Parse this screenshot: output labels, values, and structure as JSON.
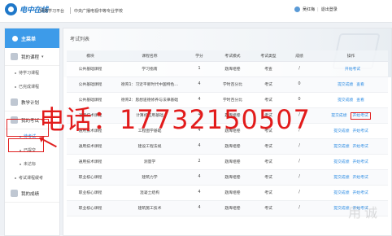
{
  "header": {
    "logo_text": "电中在线",
    "platform": "网络学习平台",
    "school": "中央广播电视中等专业学校",
    "user_name": "吴红梅",
    "logout": "退出登录"
  },
  "sidebar": {
    "title": "主菜单",
    "groups": [
      {
        "label": "我的课程"
      },
      {
        "label": "教学计划"
      },
      {
        "label": "我的考试"
      },
      {
        "label": "我的成绩"
      }
    ],
    "subs": [
      {
        "label": "待学习课程"
      },
      {
        "label": "已完成课程"
      },
      {
        "label": "待考试"
      },
      {
        "label": "已提交"
      },
      {
        "label": "未达标"
      },
      {
        "label": "考试课程缓考"
      }
    ]
  },
  "main": {
    "title": "考试列表",
    "columns": [
      "模块",
      "课程名称",
      "学分",
      "考试模式",
      "考试类型",
      "成绩",
      "操作"
    ],
    "rows": [
      {
        "module": "公共基础课程",
        "course": "学习指南",
        "credit": "1",
        "mode": "题库组卷",
        "type": "考查",
        "score": "/",
        "a1": "",
        "a2": "开始考试"
      },
      {
        "module": "公共基础课程",
        "course": "德育1：习近平新时代中国特色…",
        "credit": "4",
        "mode": "学时百分比",
        "type": "考试",
        "score": "0",
        "a1": "提交成绩",
        "a2": "查看"
      },
      {
        "module": "公共基础课程",
        "course": "德育2：思想道德修养与法律基础",
        "credit": "4",
        "mode": "学时百分比",
        "type": "考试",
        "score": "0",
        "a1": "提交成绩",
        "a2": "查看"
      },
      {
        "module": "通用技术课程",
        "course": "计算机应用基础",
        "credit": "4",
        "mode": "题库组卷",
        "type": "考试",
        "score": "/",
        "a1": "提交成绩",
        "a2": "开始考试"
      },
      {
        "module": "通用技术课程",
        "course": "工程图学基础",
        "credit": "4",
        "mode": "题库组卷",
        "type": "考试",
        "score": "/",
        "a1": "提交成绩",
        "a2": "开始考试"
      },
      {
        "module": "通用技术课程",
        "course": "建设工程法规",
        "credit": "4",
        "mode": "题库组卷",
        "type": "考试",
        "score": "/",
        "a1": "提交成绩",
        "a2": "开始考试"
      },
      {
        "module": "通用技术课程",
        "course": "测量学",
        "credit": "2",
        "mode": "题库组卷",
        "type": "考试",
        "score": "/",
        "a1": "提交成绩",
        "a2": "开始考试"
      },
      {
        "module": "职业核心课程",
        "course": "建筑力学",
        "credit": "4",
        "mode": "题库组卷",
        "type": "考试",
        "score": "/",
        "a1": "提交成绩",
        "a2": "开始考试"
      },
      {
        "module": "职业核心课程",
        "course": "混凝土结构",
        "credit": "4",
        "mode": "题库组卷",
        "type": "考试",
        "score": "/",
        "a1": "提交成绩",
        "a2": "开始考试"
      },
      {
        "module": "职业核心课程",
        "course": "建筑施工技术",
        "credit": "4",
        "mode": "题库组卷",
        "type": "考试",
        "score": "/",
        "a1": "提交成绩",
        "a2": "开始考试"
      }
    ]
  },
  "overlay": {
    "phone": "电话：17732150507",
    "watermark": "用诚"
  },
  "colors": {
    "accent": "#3d9be9",
    "link": "#2d8ce3",
    "annotation": "#e02020"
  }
}
